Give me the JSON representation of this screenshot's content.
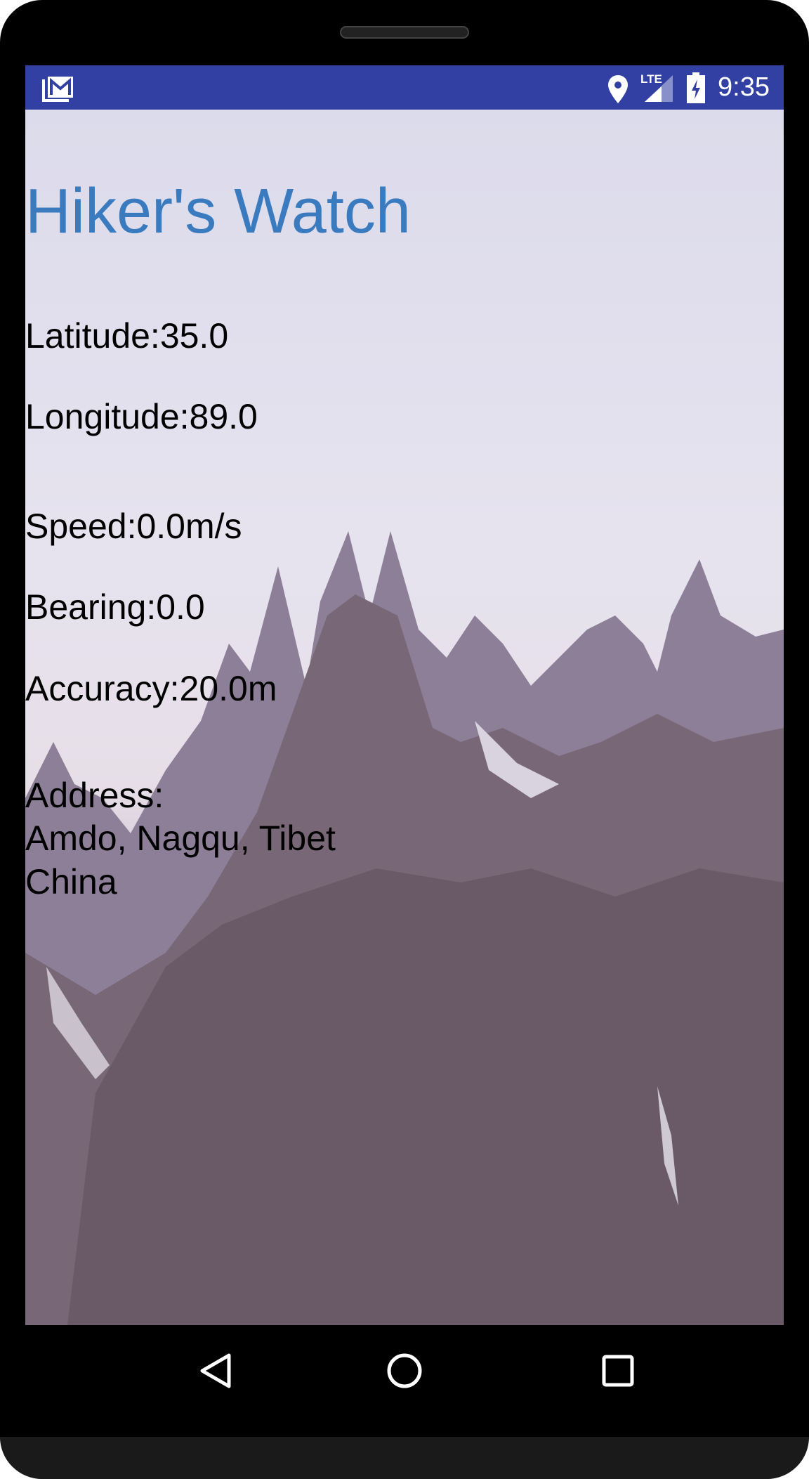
{
  "status_bar": {
    "time": "9:35",
    "network": "LTE",
    "icons": [
      "gmail-icon",
      "location-icon",
      "signal-icon",
      "battery-charging-icon"
    ]
  },
  "app": {
    "title": "Hiker's Watch",
    "latitude": "Latitude:35.0",
    "longitude": "Longitude:89.0",
    "speed": "Speed:0.0m/s",
    "bearing": "Bearing:0.0",
    "accuracy": "Accuracy:20.0m",
    "address_label": "Address:",
    "address_line1": "Amdo, Nagqu, Tibet",
    "address_line2": "China"
  },
  "nav_bar": {
    "buttons": [
      "back",
      "home",
      "recents"
    ]
  },
  "colors": {
    "status_bar": "#3140a2",
    "title": "#3a7bbf"
  }
}
